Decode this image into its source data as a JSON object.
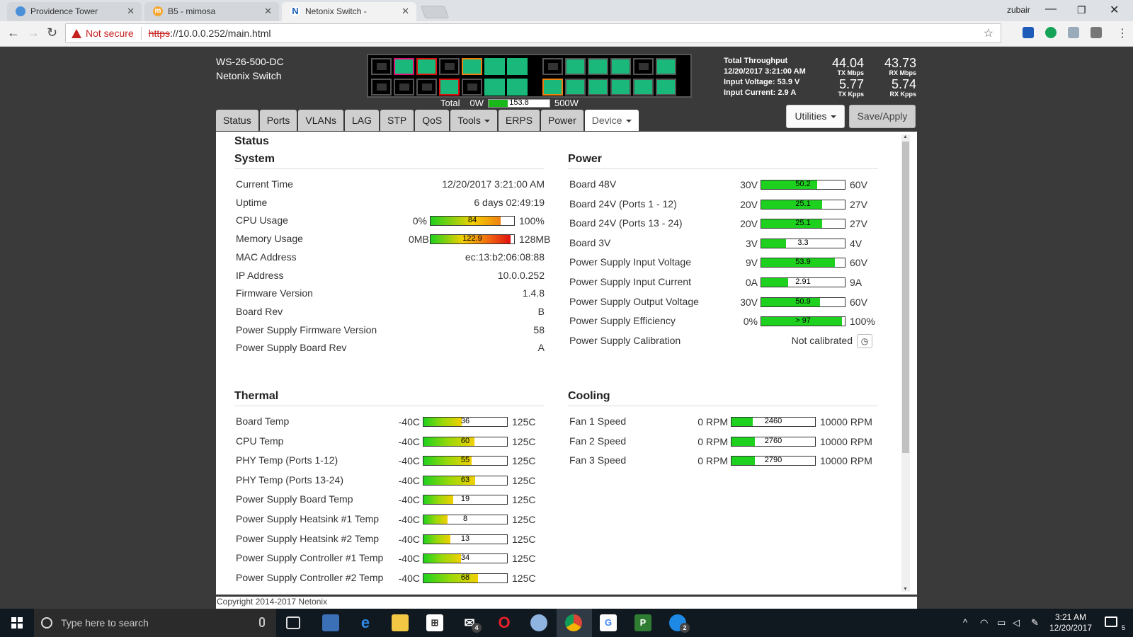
{
  "browser": {
    "tabs": [
      {
        "title": "Providence Tower",
        "fav_color": "#4a90d9",
        "fav_text": ""
      },
      {
        "title": "B5 - mimosa",
        "fav_color": "#f4a833",
        "fav_text": "m"
      },
      {
        "title": "Netonix Switch -",
        "fav_color": "#ffffff",
        "fav_text": "N"
      }
    ],
    "profile": "zubair",
    "not_secure": "Not secure",
    "url_scheme": "https",
    "url_rest": "://10.0.0.252/main.html"
  },
  "device": {
    "model": "WS-26-500-DC",
    "name": "Netonix Switch"
  },
  "ports": {
    "top": [
      "#000000",
      "#1ab87a",
      "#1ab87a",
      "#000000",
      "#1ab87a",
      "#1ab87a",
      "#1ab87a",
      "#000000",
      "#1ab87a",
      "#1ab87a",
      "#1ab87a",
      "#000000",
      "#1ab87a"
    ],
    "top_border": [
      "#555555",
      "#e0107a",
      "#e01010",
      "#555555",
      "#f08010",
      "#1ab87a",
      "#1ab87a",
      "#555555",
      "#555555",
      "#555555",
      "#555555",
      "#555555",
      "#555555"
    ],
    "bottom": [
      "#000000",
      "#000000",
      "#000000",
      "#1ab87a",
      "#000000",
      "#1ab87a",
      "#1ab87a",
      "#1ab87a",
      "#1ab87a",
      "#1ab87a",
      "#1ab87a",
      "#1ab87a",
      "#1ab87a"
    ],
    "bottom_border": [
      "#555555",
      "#555555",
      "#555555",
      "#e01010",
      "#555555",
      "#1ab87a",
      "#1ab87a",
      "#f08010",
      "#555555",
      "#555555",
      "#555555",
      "#555555",
      "#555555"
    ]
  },
  "power_total": {
    "label": "Total",
    "min": "0W",
    "value": "153.8",
    "max": "500W",
    "fraction": 0.31
  },
  "throughput": {
    "title": "Total Throughput",
    "timestamp": "12/20/2017 3:21:00 AM",
    "voltage": "Input Voltage: 53.9 V",
    "current": "Input Current: 2.9 A",
    "tx_mbps": "44.04",
    "tx_mbps_label": "TX Mbps",
    "rx_mbps": "43.73",
    "rx_mbps_label": "RX Mbps",
    "tx_kpps": "5.77",
    "tx_kpps_label": "TX Kpps",
    "rx_kpps": "5.74",
    "rx_kpps_label": "RX Kpps"
  },
  "actions": {
    "utilities": "Utilities",
    "save": "Save/Apply"
  },
  "nav": [
    "Status",
    "Ports",
    "VLANs",
    "LAG",
    "STP",
    "QoS",
    "Tools",
    "ERPS",
    "Power",
    "Device"
  ],
  "status": {
    "title": "Status",
    "system": {
      "heading": "System",
      "rows": [
        {
          "label": "Current Time",
          "value": "12/20/2017 3:21:00 AM"
        },
        {
          "label": "Uptime",
          "value": "6 days 02:49:19"
        },
        {
          "label": "CPU Usage",
          "min": "0%",
          "max": "100%",
          "value": "84",
          "fraction": 0.84,
          "fill": "linear-gradient(90deg,#1ed11e,#f2d000 60%,#f08010)"
        },
        {
          "label": "Memory Usage",
          "min": "0MB",
          "max": "128MB",
          "value": "122.9",
          "fraction": 0.96,
          "fill": "linear-gradient(90deg,#1ed11e,#f2d000 40%,#f06010 75%,#e01010)"
        },
        {
          "label": "MAC Address",
          "value": "ec:13:b2:06:08:88"
        },
        {
          "label": "IP Address",
          "value": "10.0.0.252"
        },
        {
          "label": "Firmware Version",
          "value": "1.4.8"
        },
        {
          "label": "Board Rev",
          "value": "B"
        },
        {
          "label": "Power Supply Firmware Version",
          "value": "58"
        },
        {
          "label": "Power Supply Board Rev",
          "value": "A"
        }
      ]
    },
    "power": {
      "heading": "Power",
      "rows": [
        {
          "label": "Board 48V",
          "min": "30V",
          "max": "60V",
          "value": "50.2",
          "fraction": 0.67
        },
        {
          "label": "Board 24V (Ports 1 - 12)",
          "min": "20V",
          "max": "27V",
          "value": "25.1",
          "fraction": 0.73
        },
        {
          "label": "Board 24V (Ports 13 - 24)",
          "min": "20V",
          "max": "27V",
          "value": "25.1",
          "fraction": 0.73
        },
        {
          "label": "Board 3V",
          "min": "3V",
          "max": "4V",
          "value": "3.3",
          "fraction": 0.3
        },
        {
          "label": "Power Supply Input Voltage",
          "min": "9V",
          "max": "60V",
          "value": "53.9",
          "fraction": 0.88
        },
        {
          "label": "Power Supply Input Current",
          "min": "0A",
          "max": "9A",
          "value": "2.91",
          "fraction": 0.32
        },
        {
          "label": "Power Supply Output Voltage",
          "min": "30V",
          "max": "60V",
          "value": "50.9",
          "fraction": 0.7
        },
        {
          "label": "Power Supply Efficiency",
          "min": "0%",
          "max": "100%",
          "value": "> 97",
          "fraction": 0.97
        },
        {
          "label": "Power Supply Calibration",
          "value": "Not calibrated"
        }
      ]
    },
    "thermal": {
      "heading": "Thermal",
      "rows": [
        {
          "label": "Board Temp",
          "min": "-40C",
          "max": "125C",
          "value": "36",
          "fraction": 0.46
        },
        {
          "label": "CPU Temp",
          "min": "-40C",
          "max": "125C",
          "value": "60",
          "fraction": 0.61
        },
        {
          "label": "PHY Temp (Ports 1-12)",
          "min": "-40C",
          "max": "125C",
          "value": "55",
          "fraction": 0.58
        },
        {
          "label": "PHY Temp (Ports 13-24)",
          "min": "-40C",
          "max": "125C",
          "value": "63",
          "fraction": 0.62
        },
        {
          "label": "Power Supply Board Temp",
          "min": "-40C",
          "max": "125C",
          "value": "19",
          "fraction": 0.36
        },
        {
          "label": "Power Supply Heatsink #1 Temp",
          "min": "-40C",
          "max": "125C",
          "value": "8",
          "fraction": 0.29
        },
        {
          "label": "Power Supply Heatsink #2 Temp",
          "min": "-40C",
          "max": "125C",
          "value": "13",
          "fraction": 0.32
        },
        {
          "label": "Power Supply Controller #1 Temp",
          "min": "-40C",
          "max": "125C",
          "value": "34",
          "fraction": 0.45
        },
        {
          "label": "Power Supply Controller #2 Temp",
          "min": "-40C",
          "max": "125C",
          "value": "68",
          "fraction": 0.65
        }
      ]
    },
    "cooling": {
      "heading": "Cooling",
      "rows": [
        {
          "label": "Fan 1 Speed",
          "min": "0 RPM",
          "max": "10000 RPM",
          "value": "2460",
          "fraction": 0.25
        },
        {
          "label": "Fan 2 Speed",
          "min": "0 RPM",
          "max": "10000 RPM",
          "value": "2760",
          "fraction": 0.28
        },
        {
          "label": "Fan 3 Speed",
          "min": "0 RPM",
          "max": "10000 RPM",
          "value": "2790",
          "fraction": 0.28
        }
      ]
    }
  },
  "copyright": "Copyright 2014-2017 Netonix",
  "taskbar": {
    "search_placeholder": "Type here to search",
    "clock_time": "3:21 AM",
    "clock_date": "12/20/2017",
    "mail_badge": "4",
    "messenger_badge": "2",
    "notif_count": "5"
  },
  "colors": {
    "green": "#1ed11e",
    "thermal_fill": "linear-gradient(90deg,#1ed11e,#9ad80a 50%,#f2d000)"
  }
}
